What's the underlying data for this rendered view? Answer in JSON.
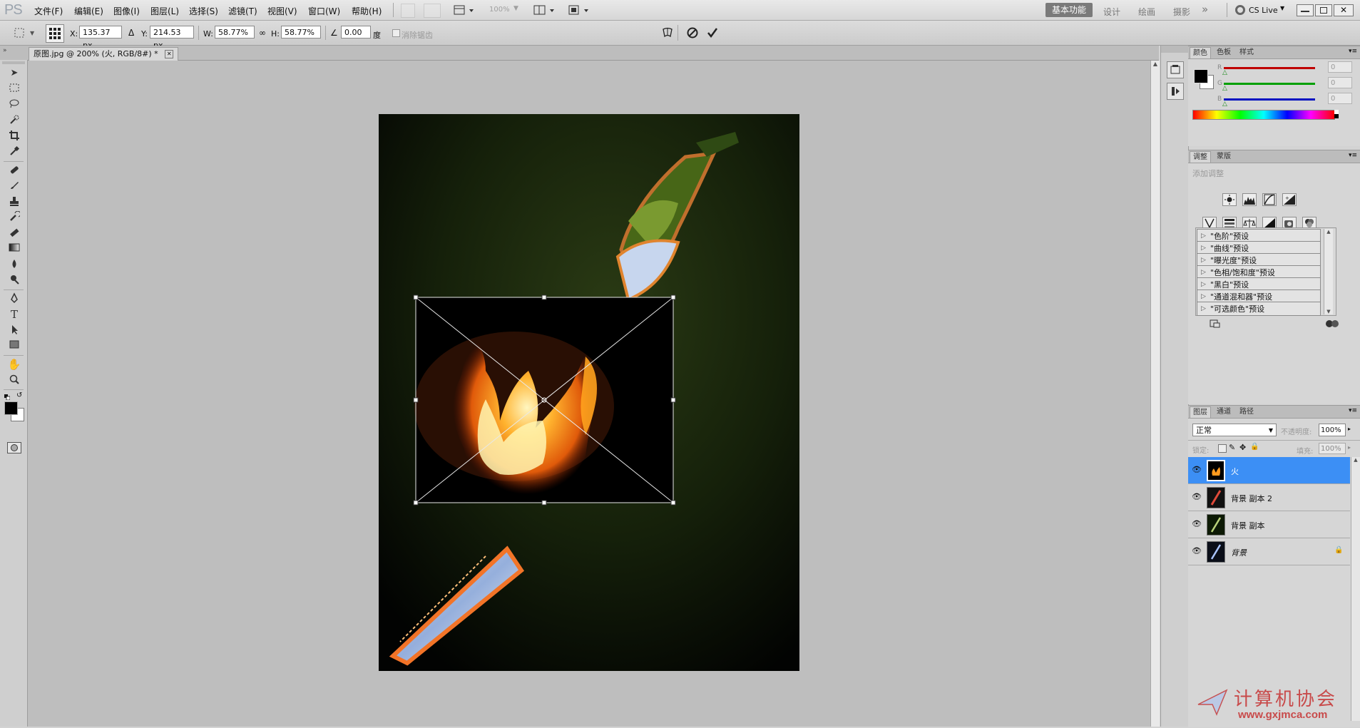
{
  "app": {
    "logo": "PS"
  },
  "menu": [
    "文件(F)",
    "编辑(E)",
    "图像(I)",
    "图层(L)",
    "选择(S)",
    "滤镜(T)",
    "视图(V)",
    "窗口(W)",
    "帮助(H)"
  ],
  "menubar": {
    "zoom": "100%",
    "ws_active": "基本功能",
    "ws_items": [
      "设计",
      "绘画",
      "摄影"
    ],
    "more": "»",
    "cs_live": "CS Live"
  },
  "options": {
    "x_label": "X:",
    "x_value": "135.37 px",
    "y_label": "Y:",
    "y_value": "214.53 px",
    "w_label": "W:",
    "w_value": "58.77%",
    "h_label": "H:",
    "h_value": "58.77%",
    "angle_value": "0.00",
    "angle_unit": "度",
    "antialias_label": "消除锯齿"
  },
  "document": {
    "tab_title": "原图.jpg @ 200% (火, RGB/8#) *"
  },
  "panels": {
    "color": {
      "tabs": [
        "颜色",
        "色板",
        "样式"
      ],
      "channels": [
        {
          "label": "R",
          "value": "0",
          "color": "#d40000"
        },
        {
          "label": "G",
          "value": "0",
          "color": "#00b000"
        },
        {
          "label": "B",
          "value": "0",
          "color": "#0010d0"
        }
      ]
    },
    "adjustments": {
      "tabs": [
        "调整",
        "蒙版"
      ],
      "title": "添加调整",
      "presets": [
        "\"色阶\"预设",
        "\"曲线\"预设",
        "\"曝光度\"预设",
        "\"色相/饱和度\"预设",
        "\"黑白\"预设",
        "\"通道混和器\"预设",
        "\"可选颜色\"预设"
      ]
    },
    "layers": {
      "tabs": [
        "图层",
        "通道",
        "路径"
      ],
      "blend_mode": "正常",
      "opacity_label": "不透明度:",
      "opacity_value": "100%",
      "lock_label": "锁定:",
      "fill_label": "填充:",
      "fill_value": "100%",
      "items": [
        {
          "name": "火",
          "selected": true
        },
        {
          "name": "背景 副本 2",
          "selected": false
        },
        {
          "name": "背景 副本",
          "selected": false
        },
        {
          "name": "背景",
          "selected": false,
          "locked": true
        }
      ]
    }
  },
  "watermark": {
    "title": "计算机协会",
    "url": "www.gxjmca.com"
  }
}
